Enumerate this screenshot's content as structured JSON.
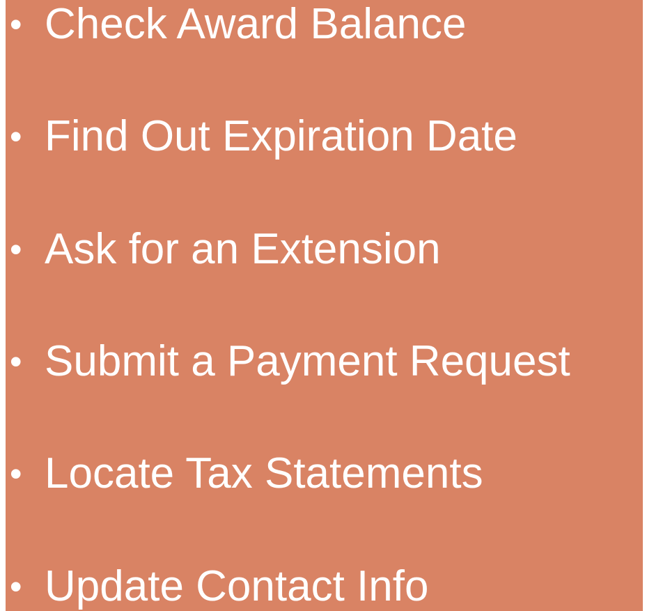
{
  "colors": {
    "panel_background": "#D98364",
    "text": "#FFFFFF",
    "page_background": "#FFFFFF"
  },
  "bullet_symbol": "•",
  "menu": {
    "items": [
      {
        "label": "Check Award Balance"
      },
      {
        "label": "Find Out Expiration Date"
      },
      {
        "label": "Ask for an Extension"
      },
      {
        "label": "Submit a Payment Request"
      },
      {
        "label": "Locate Tax Statements"
      },
      {
        "label": "Update Contact Info"
      }
    ]
  }
}
